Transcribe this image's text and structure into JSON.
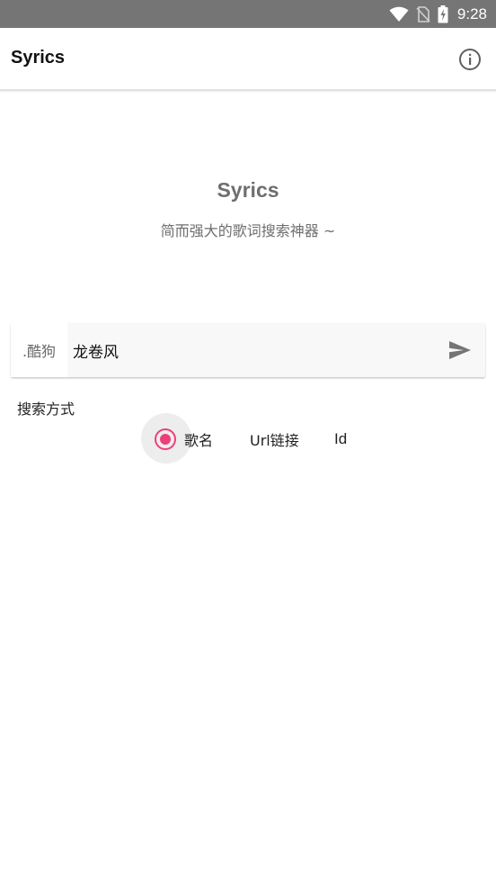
{
  "status_bar": {
    "time": "9:28",
    "icons": [
      "wifi-icon",
      "no-sim-icon",
      "battery-charging-icon"
    ]
  },
  "app_bar": {
    "title": "Syrics",
    "info_icon": "info-icon"
  },
  "hero": {
    "title": "Syrics",
    "subtitle": "简而强大的歌词搜索神器 ~"
  },
  "search": {
    "source": ".酷狗",
    "query": "龙卷风",
    "send_icon": "send-icon"
  },
  "search_mode": {
    "label": "搜索方式",
    "options": [
      {
        "label": "歌名",
        "selected": true
      },
      {
        "label": "Url链接",
        "selected": false
      },
      {
        "label": "Id",
        "selected": false
      }
    ]
  },
  "colors": {
    "status_bar": "#757575",
    "accent": "#ec407a",
    "secondary_text": "#6e6e6e"
  }
}
